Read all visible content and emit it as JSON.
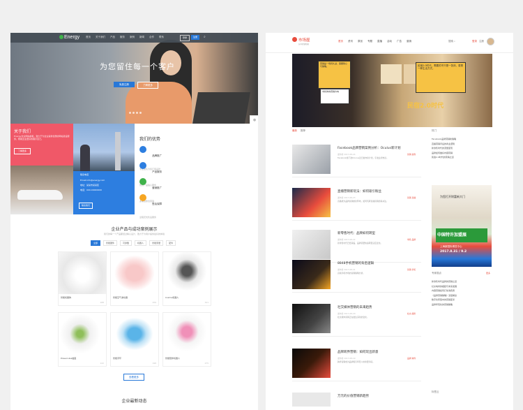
{
  "left": {
    "logo": "Energy",
    "nav": [
      "首页",
      "关于我们",
      "产品",
      "服务",
      "案例",
      "新闻",
      "合作",
      "联系"
    ],
    "login": "登录",
    "register": "注册",
    "hero": {
      "title": "为您留住每一个客户",
      "btn_primary": "免费注册",
      "btn_secondary": "了解更多"
    },
    "about": {
      "title": "关于我们",
      "text": "Energy企业网站模板，致力于为企业提供优质的网站建设服务，帮助企业更好的展示自己。",
      "button": "了解更多"
    },
    "contact": {
      "l1": "联系电话",
      "l2": "Email:info@energy.com",
      "l3": "地址：某某市某某区",
      "l4": "电话：000-00000000",
      "button": "联系我们"
    },
    "advantages": {
      "title": "我们的优势",
      "items": [
        {
          "name": "品牌推广",
          "desc": "专业团队为您打造品牌",
          "color": "#2d7ee0"
        },
        {
          "name": "产品服务",
          "desc": "优质产品贴心服务",
          "color": "#2d7ee0"
        },
        {
          "name": "营销推广",
          "desc": "多渠道整合营销",
          "color": "#3fb24a"
        },
        {
          "name": "售后保障",
          "desc": "全程无忧售后服务",
          "color": "#f6a623"
        }
      ]
    },
    "products": {
      "title": "企业产品与成功案例展示",
      "subtitle": "我们的每一个产品都经过精心设计，致力于为用户提供最好的体验",
      "tabs": [
        "全部",
        "智能硬件",
        "可穿戴",
        "机器人",
        "智能家居",
        "配件"
      ],
      "cards": [
        {
          "caption": "智能机器狗",
          "meta": "188"
        },
        {
          "caption": "智能空气净化器",
          "meta": "256"
        },
        {
          "caption": "Cozmo机器人",
          "meta": "321"
        },
        {
          "caption": "Powercube插座",
          "meta": "142"
        },
        {
          "caption": "智能手环",
          "meta": "198"
        },
        {
          "caption": "智能陪伴机器人",
          "meta": "275"
        }
      ],
      "more_button": "查看更多"
    },
    "news_title": "企业最新动态"
  },
  "right": {
    "logo_text": "市场屋",
    "logo_sub": "分享营销新知",
    "nav": [
      "首页",
      "资讯",
      "原创",
      "专题",
      "直播",
      "活动",
      "广告",
      "营销"
    ],
    "search": "搜索",
    "login": "登录",
    "register": "注册",
    "banner": {
      "box1": "营销是一场持久战，需要耐心与策略。",
      "box2": "寻找你的营销方向",
      "box3": "民宿2.0时代，需要的不只是一张床，更是一种生活方式。",
      "big": "民宿2.0时代"
    },
    "tabs": [
      "最新",
      "推荐"
    ],
    "sidebar_title": "热门",
    "sidebar_list": [
      "Facebook品牌营销新策略",
      "直播营销背后的商业逻辑",
      "新零售时代的流量变现",
      "品牌如何做好内容营销",
      "民宿2.0时代的营销之道"
    ],
    "articles": [
      {
        "title": "Facebook品牌营销案例分析：Oculus新计划",
        "meta": "发布者 2017-08-24",
        "tag": "营销·案例",
        "excerpt": "Facebook旗下的Oculus近日发布新计划，引发业界热议。"
      },
      {
        "title": "直播营销新玩法：如何吸引粉丝",
        "meta": "发布者 2017-08-23",
        "tag": "营销·直播",
        "excerpt": "直播成为品牌营销的新阵地，如何玩转直播营销值得关注。"
      },
      {
        "title": "新零售时代：品牌如何转型",
        "meta": "发布者 2017-08-22",
        "tag": "零售·品牌",
        "excerpt": "新零售时代已经来临，品牌需要快速转型适应变化。"
      },
      {
        "title": "8848手机营销的背后逻辑",
        "meta": "发布者 2017-08-21",
        "tag": "营销·手机",
        "excerpt": "高端手机市场的营销策略分析。"
      },
      {
        "title": "社交媒体营销的未来趋势",
        "meta": "发布者 2017-08-20",
        "tag": "社交·趋势",
        "excerpt": "社交媒体营销正在发生深刻的变化。"
      },
      {
        "title": "品牌跨界营销：如何玩出新意",
        "meta": "发布者 2017-08-19",
        "tag": "品牌·跨界",
        "excerpt": "跨界营销成为品牌吸引年轻人的重要手段。"
      }
    ],
    "last_article": "万元的价值营销新趋势",
    "ad": {
      "t0": "为您打开财富新大门",
      "t1": "中国特许加盟展",
      "t2": "上海新国际博览中心",
      "t3": "2017.8.31 / 9.2"
    },
    "expert_title": "专家观点",
    "expert_more": "更多",
    "expert_list": [
      "新零售时代品牌的营销之道",
      "社交电商的崛起与未来发展",
      "内容营销如何打动消费者",
      "《品牌营销策略》深度解读",
      "数字化转型中的营销变革",
      "品牌年轻化的营销策略"
    ],
    "tag_title": "标签云"
  }
}
